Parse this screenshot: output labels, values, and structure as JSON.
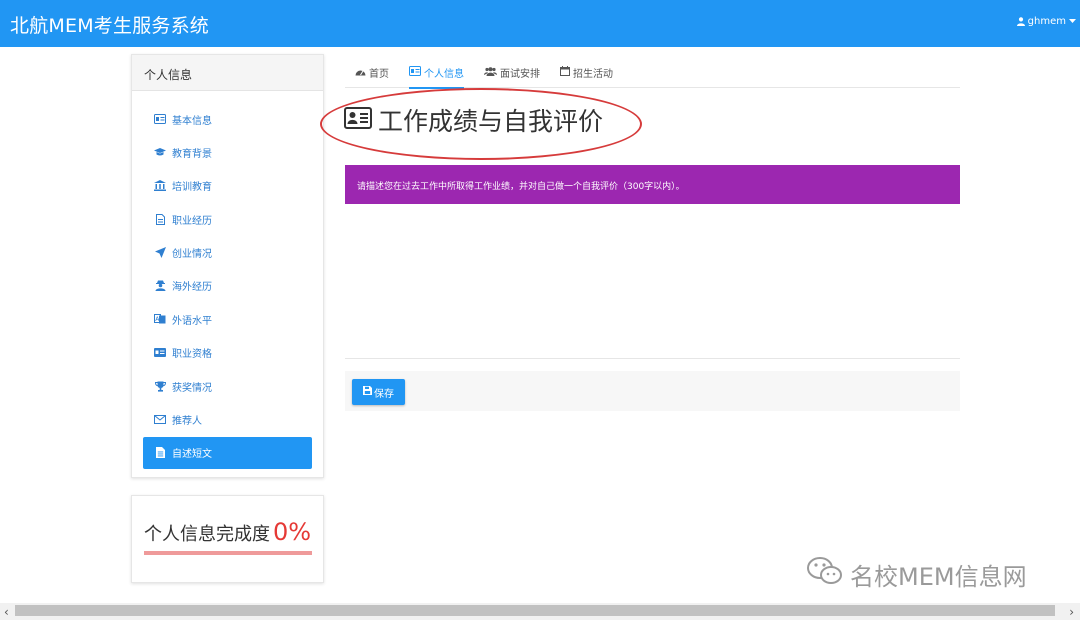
{
  "app": {
    "brand": "北航MEM考生服务系统",
    "user": "ghmem",
    "colors": {
      "primary": "#2196f3",
      "notice": "#9c27b0",
      "accent_red": "#e53935"
    }
  },
  "sidebar": {
    "title": "个人信息",
    "items": [
      {
        "label": "基本信息",
        "icon": "id-card-icon"
      },
      {
        "label": "教育背景",
        "icon": "graduation-cap-icon"
      },
      {
        "label": "培训教育",
        "icon": "institution-icon"
      },
      {
        "label": "职业经历",
        "icon": "file-icon"
      },
      {
        "label": "创业情况",
        "icon": "rocket-icon"
      },
      {
        "label": "海外经历",
        "icon": "user-secret-icon"
      },
      {
        "label": "外语水平",
        "icon": "language-icon"
      },
      {
        "label": "职业资格",
        "icon": "credit-card-icon"
      },
      {
        "label": "获奖情况",
        "icon": "trophy-icon"
      },
      {
        "label": "推荐人",
        "icon": "envelope-icon"
      },
      {
        "label": "自述短文",
        "icon": "file-text-icon",
        "active": true
      }
    ]
  },
  "completion": {
    "label": "个人信息完成度",
    "value": "0%",
    "percent": 0
  },
  "tabs": [
    {
      "label": "首页",
      "icon": "dashboard-icon"
    },
    {
      "label": "个人信息",
      "icon": "id-card-icon",
      "active": true
    },
    {
      "label": "面试安排",
      "icon": "users-icon"
    },
    {
      "label": "招生活动",
      "icon": "calendar-icon"
    }
  ],
  "main": {
    "title": "工作成绩与自我评价",
    "notice": "请描述您在过去工作中所取得工作业绩，并对自己做一个自我评价（300字以内）。",
    "save_label": "保存"
  },
  "watermark": "名校MEM信息网"
}
